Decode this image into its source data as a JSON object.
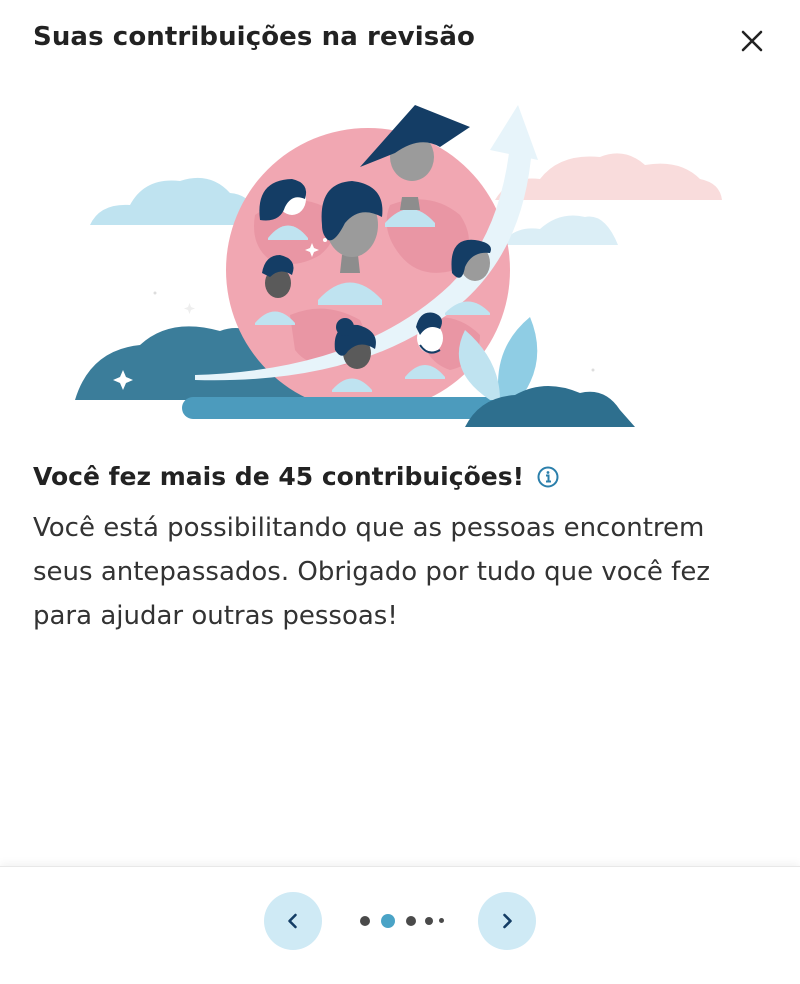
{
  "dialog": {
    "title": "Suas contribuições na revisão",
    "close_icon": "close-icon"
  },
  "illustration": {
    "description_icon": "globe-people-illustration",
    "colors": {
      "globe": "#f1a7b2",
      "globe_land": "#e68f9e",
      "cloud_blue": "#bfe3f0",
      "cloud_pink": "#f9dcdc",
      "navy": "#143d65",
      "teal": "#3b7d9a",
      "arrow": "#e7f4fa"
    }
  },
  "content": {
    "heading": "Você fez mais de 45 contribuições!",
    "info_icon": "info-icon",
    "body": "Você está possibilitando que as pessoas encontrem seus antepassados. Obrigado por tudo que você fez para ajudar outras pessoas!"
  },
  "pagination": {
    "prev_icon": "chevron-left-icon",
    "next_icon": "chevron-right-icon",
    "current_page": 2,
    "accent": "#4aa3c6"
  }
}
